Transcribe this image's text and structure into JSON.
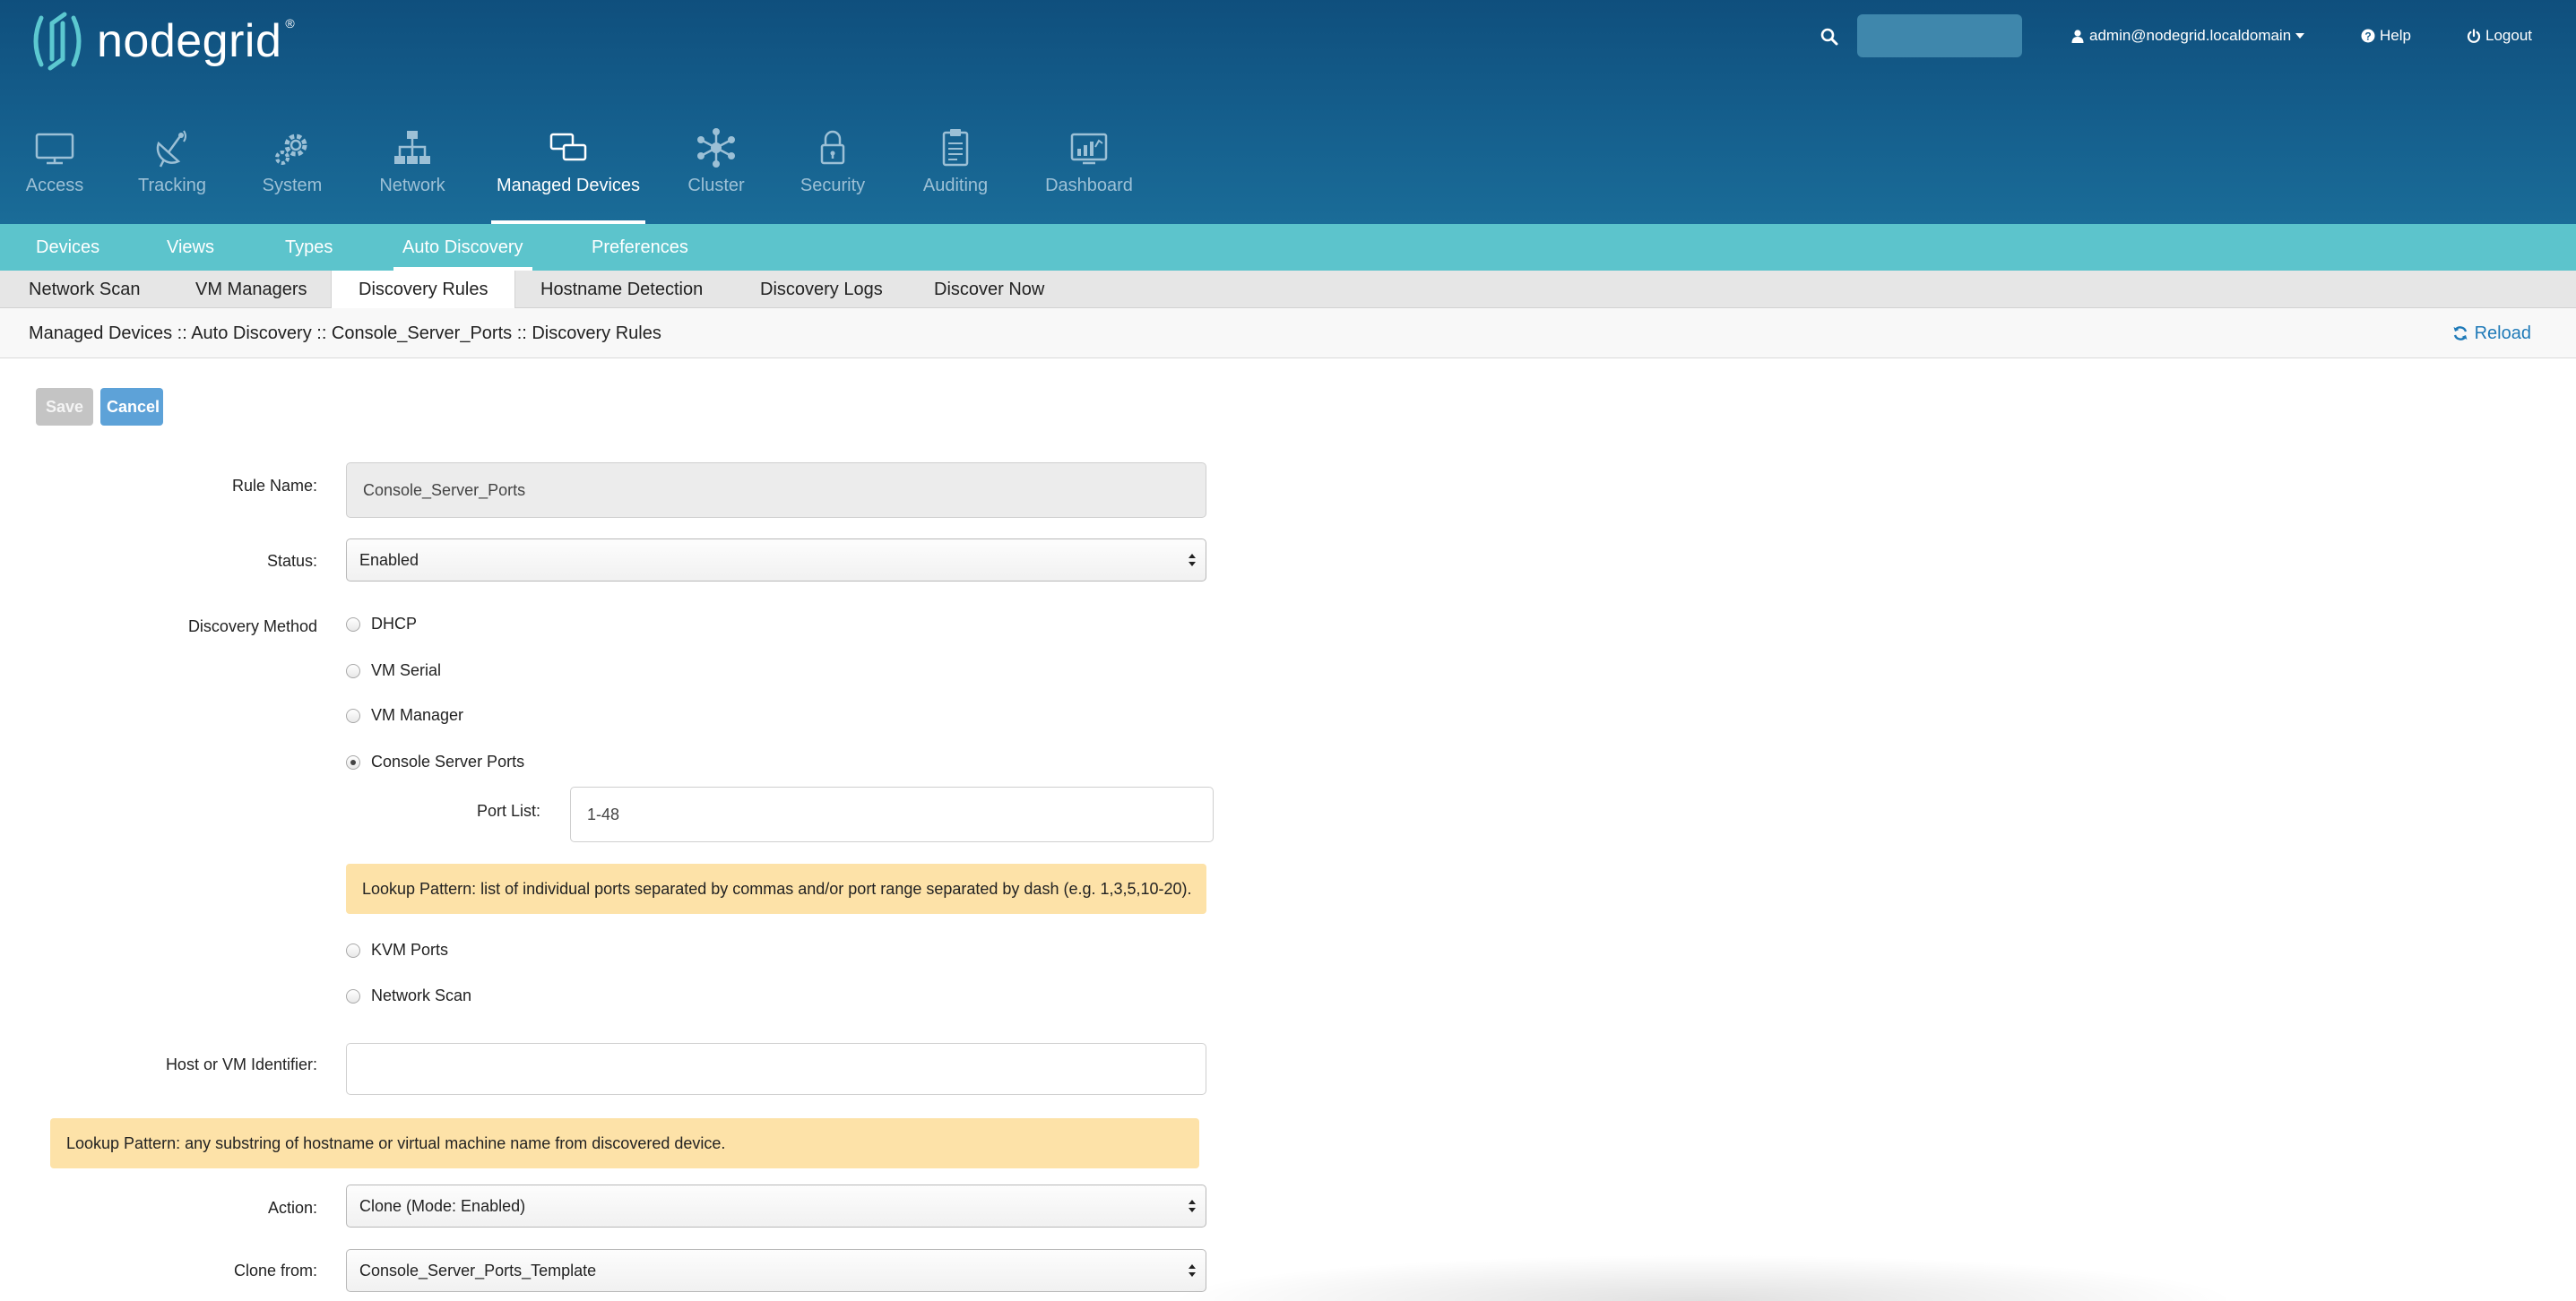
{
  "brand": {
    "name": "nodegrid",
    "registered": "®"
  },
  "header": {
    "search_placeholder": "",
    "user": "admin@nodegrid.localdomain",
    "help": "Help",
    "logout": "Logout"
  },
  "nav": {
    "items": [
      {
        "label": "Access",
        "icon": "monitor-icon"
      },
      {
        "label": "Tracking",
        "icon": "satellite-dish-icon"
      },
      {
        "label": "System",
        "icon": "gears-icon"
      },
      {
        "label": "Network",
        "icon": "network-tree-icon"
      },
      {
        "label": "Managed Devices",
        "icon": "devices-icon"
      },
      {
        "label": "Cluster",
        "icon": "cluster-icon"
      },
      {
        "label": "Security",
        "icon": "lock-icon"
      },
      {
        "label": "Auditing",
        "icon": "clipboard-icon"
      },
      {
        "label": "Dashboard",
        "icon": "dashboard-icon"
      }
    ],
    "active": "Managed Devices"
  },
  "subtabs": [
    "Devices",
    "Views",
    "Types",
    "Auto Discovery",
    "Preferences"
  ],
  "subtab_active": "Auto Discovery",
  "thirdtabs": [
    "Network Scan",
    "VM Managers",
    "Discovery Rules",
    "Hostname Detection",
    "Discovery Logs",
    "Discover Now"
  ],
  "thirdtab_active": "Discovery Rules",
  "breadcrumb": "Managed Devices :: Auto Discovery :: Console_Server_Ports :: Discovery Rules",
  "reload": "Reload",
  "buttons": {
    "save": "Save",
    "cancel": "Cancel"
  },
  "form": {
    "rule_name_label": "Rule Name:",
    "rule_name_value": "Console_Server_Ports",
    "status_label": "Status:",
    "status_value": "Enabled",
    "discovery_method_label": "Discovery Method",
    "methods": {
      "dhcp": "DHCP",
      "vm_serial": "VM Serial",
      "vm_manager": "VM Manager",
      "console_server_ports": "Console Server Ports",
      "kvm_ports": "KVM Ports",
      "network_scan": "Network Scan"
    },
    "method_selected": "Console Server Ports",
    "port_list_label": "Port List:",
    "port_list_value": "1-48",
    "port_hint": "Lookup Pattern: list of individual ports separated by commas and/or port range separated by dash (e.g. 1,3,5,10-20).",
    "host_label": "Host or VM Identifier:",
    "host_value": "",
    "host_hint": "Lookup Pattern: any substring of hostname or virtual machine name from discovered device.",
    "action_label": "Action:",
    "action_value": "Clone (Mode: Enabled)",
    "clone_from_label": "Clone from:",
    "clone_from_value": "Console_Server_Ports_Template"
  },
  "colors": {
    "header_top": "#0f4f7d",
    "header_bottom": "#1a6c98",
    "subbar": "#5cc4cc",
    "hint_bg": "#fde2a8",
    "link": "#1f7ab8",
    "cancel_button": "#5da2d8"
  }
}
